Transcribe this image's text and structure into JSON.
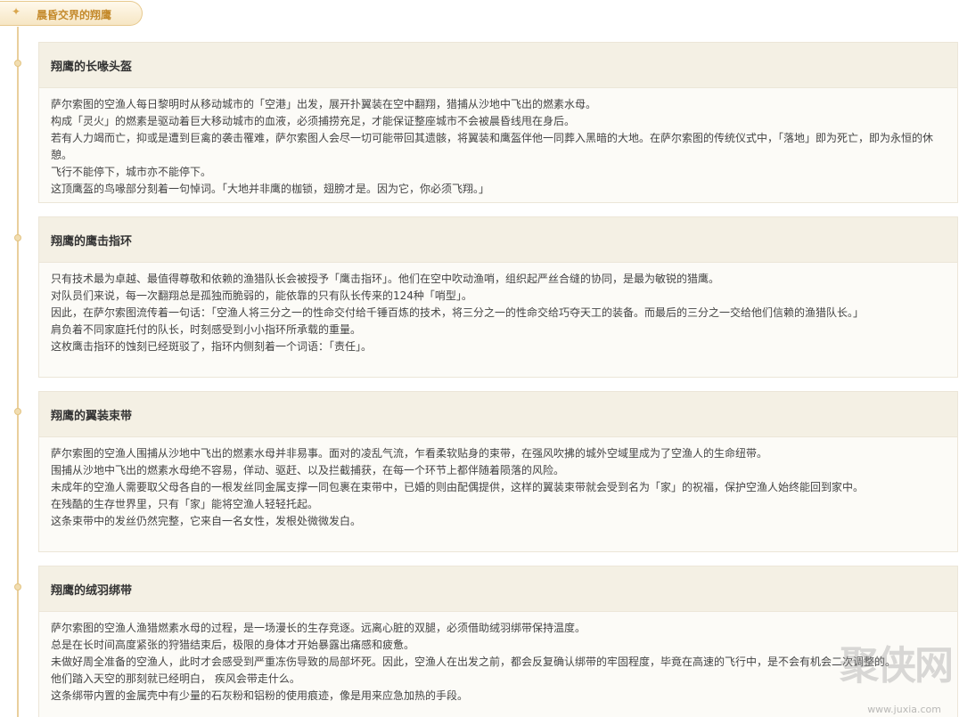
{
  "tab": {
    "icon": "sparkle-icon",
    "label": "晨昏交界的翔鹰"
  },
  "cards": [
    {
      "title": "翔鹰的长喙头盔",
      "lines": [
        "萨尔索图的空渔人每日黎明时从移动城市的「空港」出发，展开扑翼装在空中翻翔，猎捕从沙地中飞出的燃素水母。",
        "构成「灵火」的燃素是驱动着巨大移动城市的血液，必须捕捞充足，才能保证整座城市不会被晨昏线甩在身后。",
        "若有人力竭而亡，抑或是遭到巨禽的袭击罹难，萨尔索图人会尽一切可能带回其遗骸，将翼装和鹰盔伴他一同葬入黑暗的大地。在萨尔索图的传统仪式中，「落地」即为死亡，即为永恒的休憩。",
        "飞行不能停下，城市亦不能停下。",
        "这顶鹰盔的鸟喙部分刻着一句悼词。「大地并非鹰的枷锁，翅膀才是。因为它，你必须飞翔。」"
      ]
    },
    {
      "title": "翔鹰的鹰击指环",
      "lines": [
        "只有技术最为卓越、最值得尊敬和依赖的渔猎队长会被授予「鹰击指环」。他们在空中吹动渔哨，组织起严丝合缝的协同，是最为敏锐的猎鹰。",
        "对队员们来说，每一次翻翔总是孤独而脆弱的，能依靠的只有队长传来的124种「哨型」。",
        "因此，在萨尔索图流传着一句话：「空渔人将三分之一的性命交付给千锤百炼的技术，将三分之一的性命交给巧夺天工的装备。而最后的三分之一交给他们信赖的渔猎队长。」",
        "肩负着不同家庭托付的队长，时刻感受到小小指环所承载的重量。",
        "这枚鹰击指环的蚀刻已经斑驳了，指环内侧刻着一个词语：「责任」。"
      ]
    },
    {
      "title": "翔鹰的翼装束带",
      "lines": [
        "萨尔索图的空渔人围捕从沙地中飞出的燃素水母并非易事。面对的凌乱气流，乍看柔软贴身的束带，在强风吹拂的城外空域里成为了空渔人的生命纽带。",
        "围捕从沙地中飞出的燃素水母绝不容易，佯动、驱赶、以及拦截捕获，在每一个环节上都伴随着陨落的风险。",
        "未成年的空渔人需要取父母各自的一根发丝同金属支撑一同包裹在束带中，已婚的则由配偶提供，这样的翼装束带就会受到名为「家」的祝福，保护空渔人始终能回到家中。",
        "在残酷的生存世界里，只有「家」能将空渔人轻轻托起。",
        "这条束带中的发丝仍然完整，它来自一名女性，发根处微微发白。"
      ]
    },
    {
      "title": "翔鹰的绒羽绑带",
      "lines": [
        "萨尔索图的空渔人渔猎燃素水母的过程，是一场漫长的生存竞逐。远离心脏的双腿，必须借助绒羽绑带保持温度。",
        "总是在长时间高度紧张的狩猎结束后，极限的身体才开始暴露出痛感和疲惫。",
        "未做好周全准备的空渔人，此时才会感受到严重冻伤导致的局部坏死。因此，空渔人在出发之前，都会反复确认绑带的牢固程度，毕竟在高速的飞行中，是不会有机会二次调整的。",
        "他们踏入天空的那刻就已经明白， 疾风会带走什么。",
        "这条绑带内置的金属壳中有少量的石灰粉和铝粉的使用痕迹，像是用来应急加热的手段。"
      ]
    }
  ],
  "watermark": {
    "glyphs": "聚侠网",
    "url": "www.juxia.com"
  }
}
